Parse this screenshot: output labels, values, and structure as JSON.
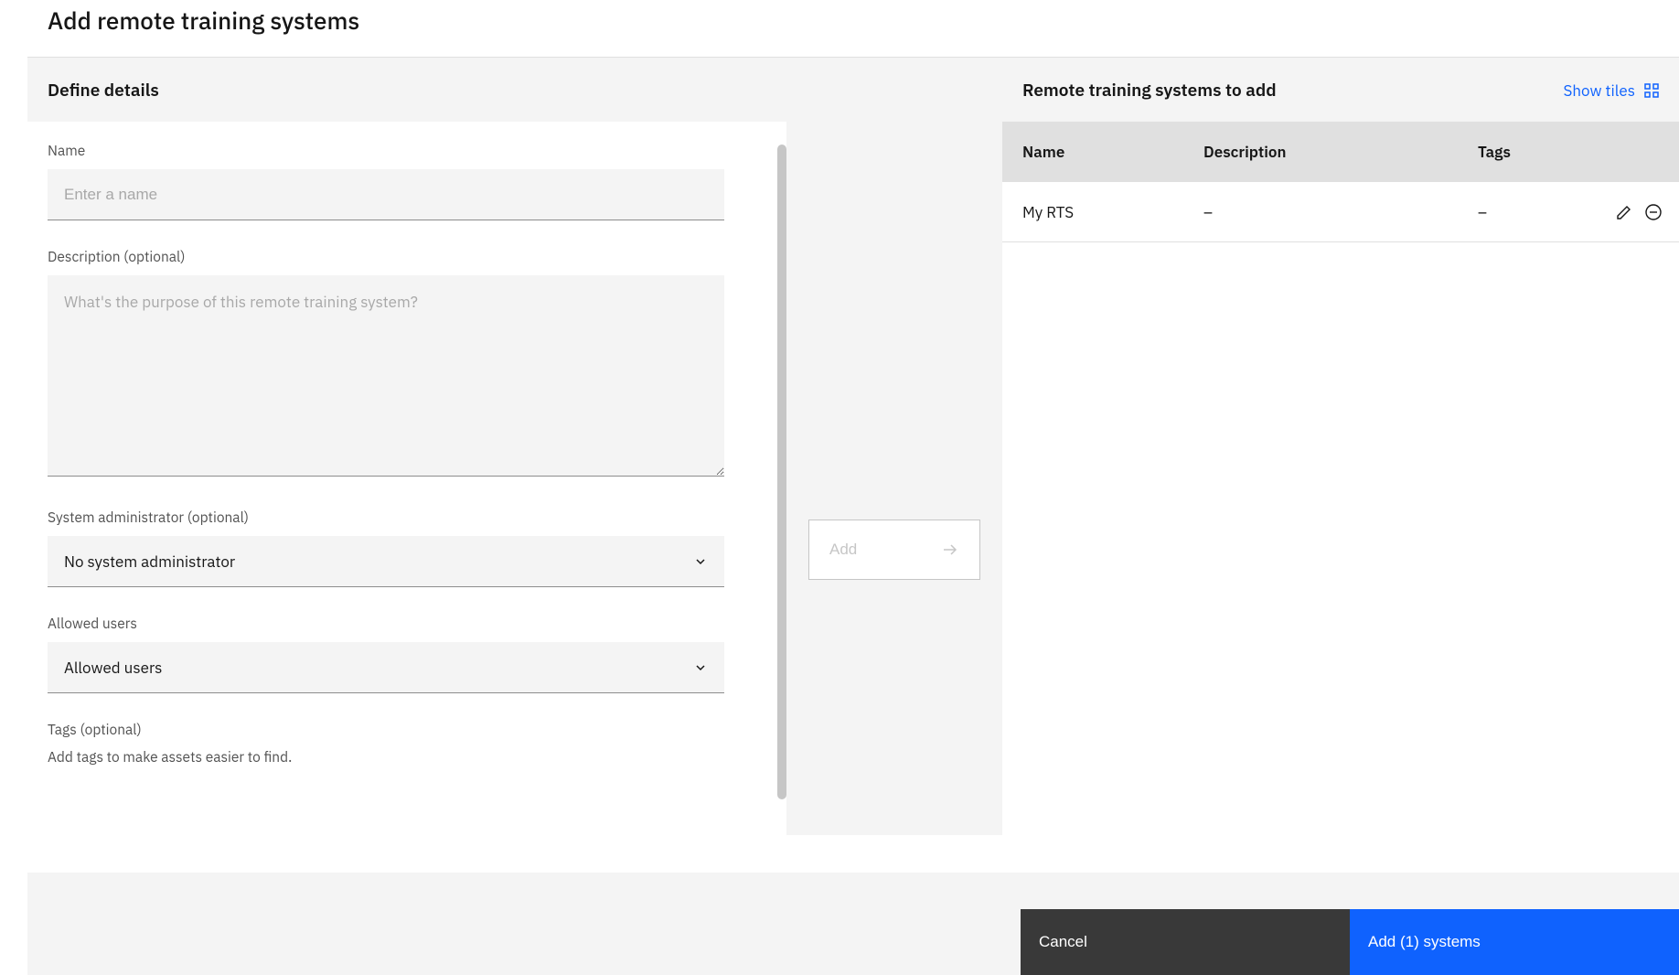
{
  "page": {
    "title": "Add remote training systems"
  },
  "left": {
    "header": "Define details",
    "name_label": "Name",
    "name_placeholder": "Enter a name",
    "desc_label": "Description (optional)",
    "desc_placeholder": "What's the purpose of this remote training system?",
    "sysadmin_label": "System administrator (optional)",
    "sysadmin_selected": "No system administrator",
    "allowed_label": "Allowed users",
    "allowed_selected": "Allowed users",
    "tags_label": "Tags (optional)",
    "tags_helper": "Add tags to make assets easier to find."
  },
  "middle": {
    "add_label": "Add"
  },
  "right": {
    "header": "Remote training systems to add",
    "show_tiles": "Show tiles",
    "columns": {
      "name": "Name",
      "desc": "Description",
      "tags": "Tags"
    },
    "rows": [
      {
        "name": "My RTS",
        "desc": "–",
        "tags": "–"
      }
    ]
  },
  "footer": {
    "cancel": "Cancel",
    "submit": "Add (1) systems"
  }
}
